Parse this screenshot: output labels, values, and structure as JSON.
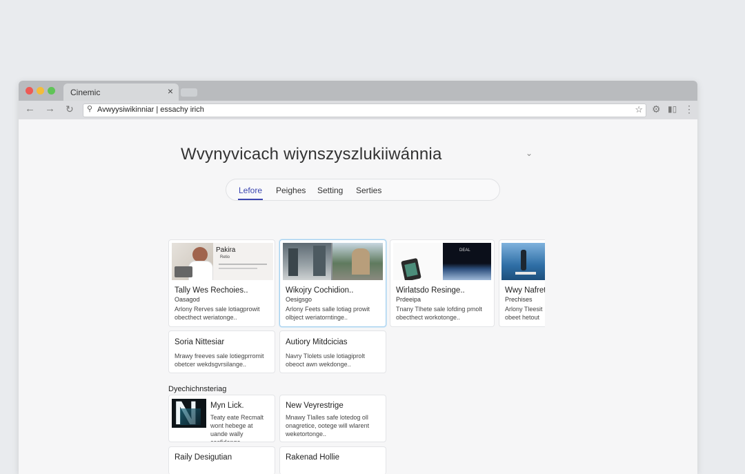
{
  "browser": {
    "tab_title": "Cinemic",
    "tab_close": "×",
    "address": "Avwyysiwikinniar | essachy irich",
    "colors": {
      "close": "#ed5a55",
      "minimize": "#f3bc3b",
      "maximize": "#5fc457"
    }
  },
  "page": {
    "title": "Wvynyvicach wiynszyszlukiiwánnia",
    "tabs": [
      "Lefore",
      "Peighes",
      "Setting",
      "Serties"
    ],
    "active_tab": "Lefore"
  },
  "cards_row1": [
    {
      "title": "Tally Wes Rechoies..",
      "subtitle": "Oasagod",
      "desc": "Arlony Rerves sale lotiagprowit obecthect weriatonge..",
      "thumb_caption": "Pakira",
      "thumb_sub": "Retio"
    },
    {
      "title": "Wikojry Cochidion..",
      "subtitle": "Oesigsgo",
      "desc": "Arlony Feets salle lotiag prowit olbject weriatorntinge..",
      "thumb_caption": "",
      "thumb_sub": ""
    },
    {
      "title": "Wirlatsdo Resinge..",
      "subtitle": "Prdeeipa",
      "desc": "Tnany Tlhete sale lofding pmolt obecthect workotonge..",
      "thumb_caption": "DEAL",
      "thumb_sub": ""
    },
    {
      "title": "Wwy Nafret",
      "subtitle": "Prechises",
      "desc": "Arlony Tleesit obeet hetout",
      "thumb_caption": "",
      "thumb_sub": ""
    }
  ],
  "cards_row2": [
    {
      "title": "Soria Nittesiar",
      "desc": "Mrawy freeves sale lotiegprromit obetcer wekdsgvrsilange.."
    },
    {
      "title": "Autiory Mitdcicias",
      "desc": "Navry Tlolets usle lotiagiprolt obeoct awn wekdonge.."
    }
  ],
  "section": {
    "label": "Dyechichnsteriag"
  },
  "cards_row3": [
    {
      "title": "Myn Lick.",
      "desc": "Teaty eate Recmalt wont hebege at uande wally cosfidonge..",
      "thumb_letter": "N"
    },
    {
      "title": "New Veyrestrige",
      "desc": "Mnawy Tlalles safe lotedog oll onagretice, ootege will wlarent weketortonge.."
    }
  ],
  "cards_row4": [
    {
      "title": "Raily Desigutian"
    },
    {
      "title": "Rakenad Hollie"
    }
  ],
  "icons": [
    "back-icon",
    "forward-icon",
    "reload-icon",
    "search-icon",
    "star-icon",
    "extension-icon",
    "cast-icon",
    "menu-icon",
    "chevron-down-icon"
  ]
}
